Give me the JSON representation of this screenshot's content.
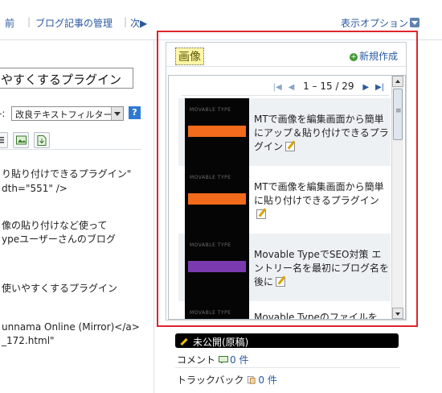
{
  "topbar": {
    "prev_label": "前",
    "manage_label": "ブログ記事の管理",
    "next_label": "次",
    "display_options_label": "表示オプション"
  },
  "editor": {
    "title_value": "やすくするプラグイン",
    "filter_label": "-:",
    "filter_value": "改良テキストフィルター",
    "help_label": "?",
    "code_lines": [
      "り貼り付けできるプラグイン\"",
      "dth=\"551\" />",
      "像の貼り付けなど使って",
      "ypeユーザーさんのブログ",
      "使いやすくするプラグイン",
      "unnama Online (Mirror)</a>",
      "_172.html\""
    ]
  },
  "widget": {
    "title": "画像",
    "new_label": "新規作成",
    "pager": {
      "range": "1 – 15 / 29"
    },
    "items": [
      {
        "text": "MTで画像を編集画面から簡単にアップ＆貼り付けできるプラグイン",
        "logo": "MOVABLE TYPE",
        "bar_color": "#f26a1b"
      },
      {
        "text": "MTで画像を編集画面から簡単に貼り付けできるプラグイン",
        "logo": "MOVABLE TYPE",
        "bar_color": "#f26a1b"
      },
      {
        "text": "Movable TypeでSEO対策 エントリー名を最初にブログ名を後に",
        "logo": "MOVABLE TYPE",
        "bar_color": "#7a3bb0"
      },
      {
        "text": "Movable TypeのファイルをPHP化",
        "logo": "MOVABLE TYPE",
        "bar_color": "#f26a1b"
      }
    ]
  },
  "status": {
    "state_label": "未公開(原稿)",
    "comment_label": "コメント",
    "comment_count": "0 件",
    "trackback_label": "トラックバック",
    "trackback_count": "0 件"
  },
  "colors": {
    "highlight_border": "#e0242c",
    "link": "#2b5aa0",
    "status_bg": "#000000"
  }
}
